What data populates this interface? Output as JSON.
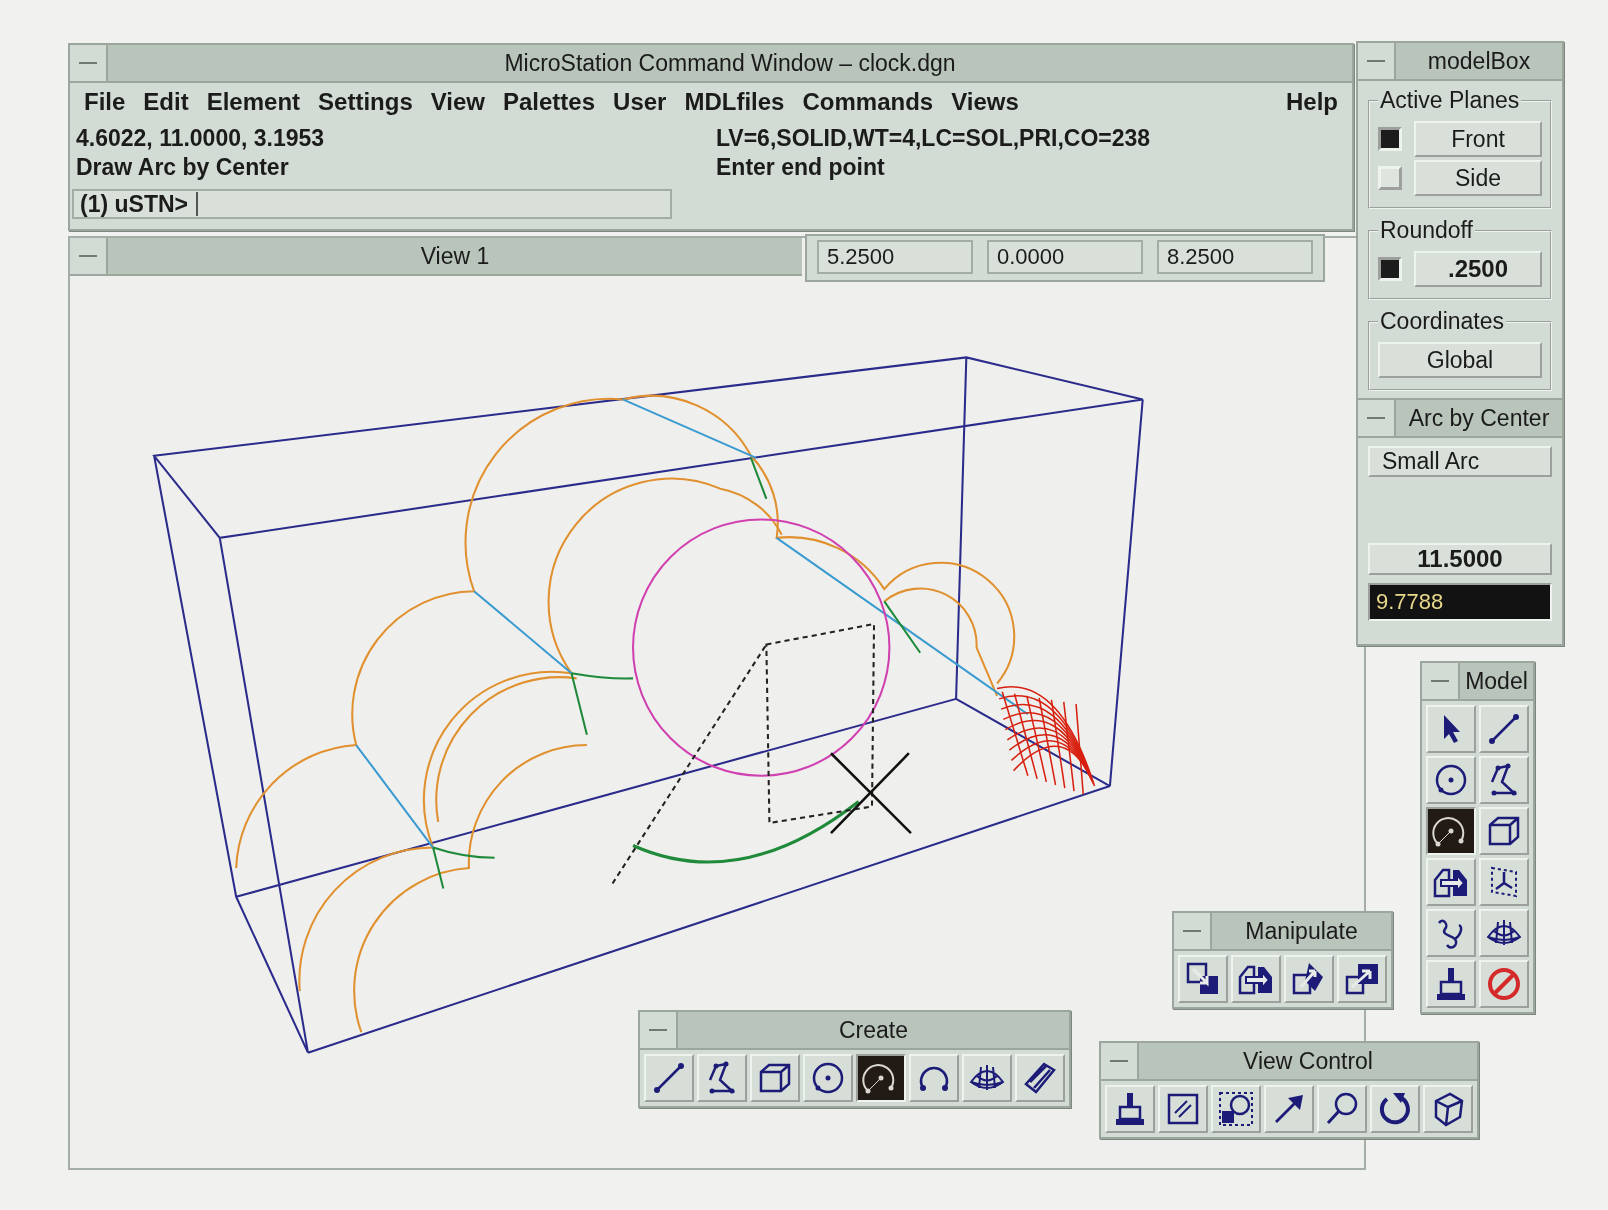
{
  "command_window": {
    "title": "MicroStation Command Window – clock.dgn",
    "menu": [
      "File",
      "Edit",
      "Element",
      "Settings",
      "View",
      "Palettes",
      "User",
      "MDLfiles",
      "Commands",
      "Views"
    ],
    "help_menu": "Help",
    "coordinates": "4.6022, 11.0000, 3.1953",
    "command": "Draw Arc by Center",
    "element_settings": "LV=6,SOLID,WT=4,LC=SOL,PRI,CO=238",
    "prompt": "Enter end point",
    "keyin_prompt": "(1) uSTN>"
  },
  "view": {
    "title": "View 1",
    "fields": [
      "5.2500",
      "0.0000",
      "8.2500"
    ]
  },
  "model_box": {
    "title": "modelBox",
    "active_planes": {
      "label": "Active Planes",
      "planes": [
        {
          "label": "Front",
          "checked": true
        },
        {
          "label": "Side",
          "checked": false
        }
      ]
    },
    "roundoff": {
      "label": "Roundoff",
      "checked": true,
      "value": ".2500"
    },
    "coordinates": {
      "label": "Coordinates",
      "value": "Global"
    }
  },
  "arc_settings": {
    "title": "Arc by Center",
    "mode": "Small Arc",
    "value": "11.5000",
    "input": "9.7788"
  },
  "palettes": [
    {
      "title": "Model",
      "tools": [
        {
          "kind": "select",
          "selected": false
        },
        {
          "kind": "line",
          "selected": false
        },
        {
          "kind": "circle",
          "selected": false
        },
        {
          "kind": "polyline",
          "selected": false
        },
        {
          "kind": "arc",
          "selected": true
        },
        {
          "kind": "cube",
          "selected": false
        },
        {
          "kind": "split",
          "selected": false
        },
        {
          "kind": "axes",
          "selected": false
        },
        {
          "kind": "curve",
          "selected": false
        },
        {
          "kind": "mesh",
          "selected": false
        },
        {
          "kind": "brush",
          "selected": false
        },
        {
          "kind": "prohibited",
          "selected": false
        }
      ]
    },
    {
      "title": "Manipulate",
      "tools": [
        {
          "kind": "move",
          "selected": false
        },
        {
          "kind": "split",
          "selected": false
        },
        {
          "kind": "rotate-arrow",
          "selected": false
        },
        {
          "kind": "scale",
          "selected": false
        }
      ]
    },
    {
      "title": "Create",
      "tools": [
        {
          "kind": "line",
          "selected": false
        },
        {
          "kind": "polyline",
          "selected": false
        },
        {
          "kind": "cube",
          "selected": false
        },
        {
          "kind": "circle",
          "selected": false
        },
        {
          "kind": "arc",
          "selected": true
        },
        {
          "kind": "open-arc",
          "selected": false
        },
        {
          "kind": "mesh",
          "selected": false
        },
        {
          "kind": "slab",
          "selected": false
        }
      ]
    },
    {
      "title": "View Control",
      "tools": [
        {
          "kind": "brush",
          "selected": false
        },
        {
          "kind": "hatched",
          "selected": false
        },
        {
          "kind": "window-zoom",
          "selected": false
        },
        {
          "kind": "arrow",
          "selected": false
        },
        {
          "kind": "magnifier",
          "selected": false
        },
        {
          "kind": "rotate",
          "selected": false
        },
        {
          "kind": "wire-cube",
          "selected": false
        }
      ]
    }
  ]
}
